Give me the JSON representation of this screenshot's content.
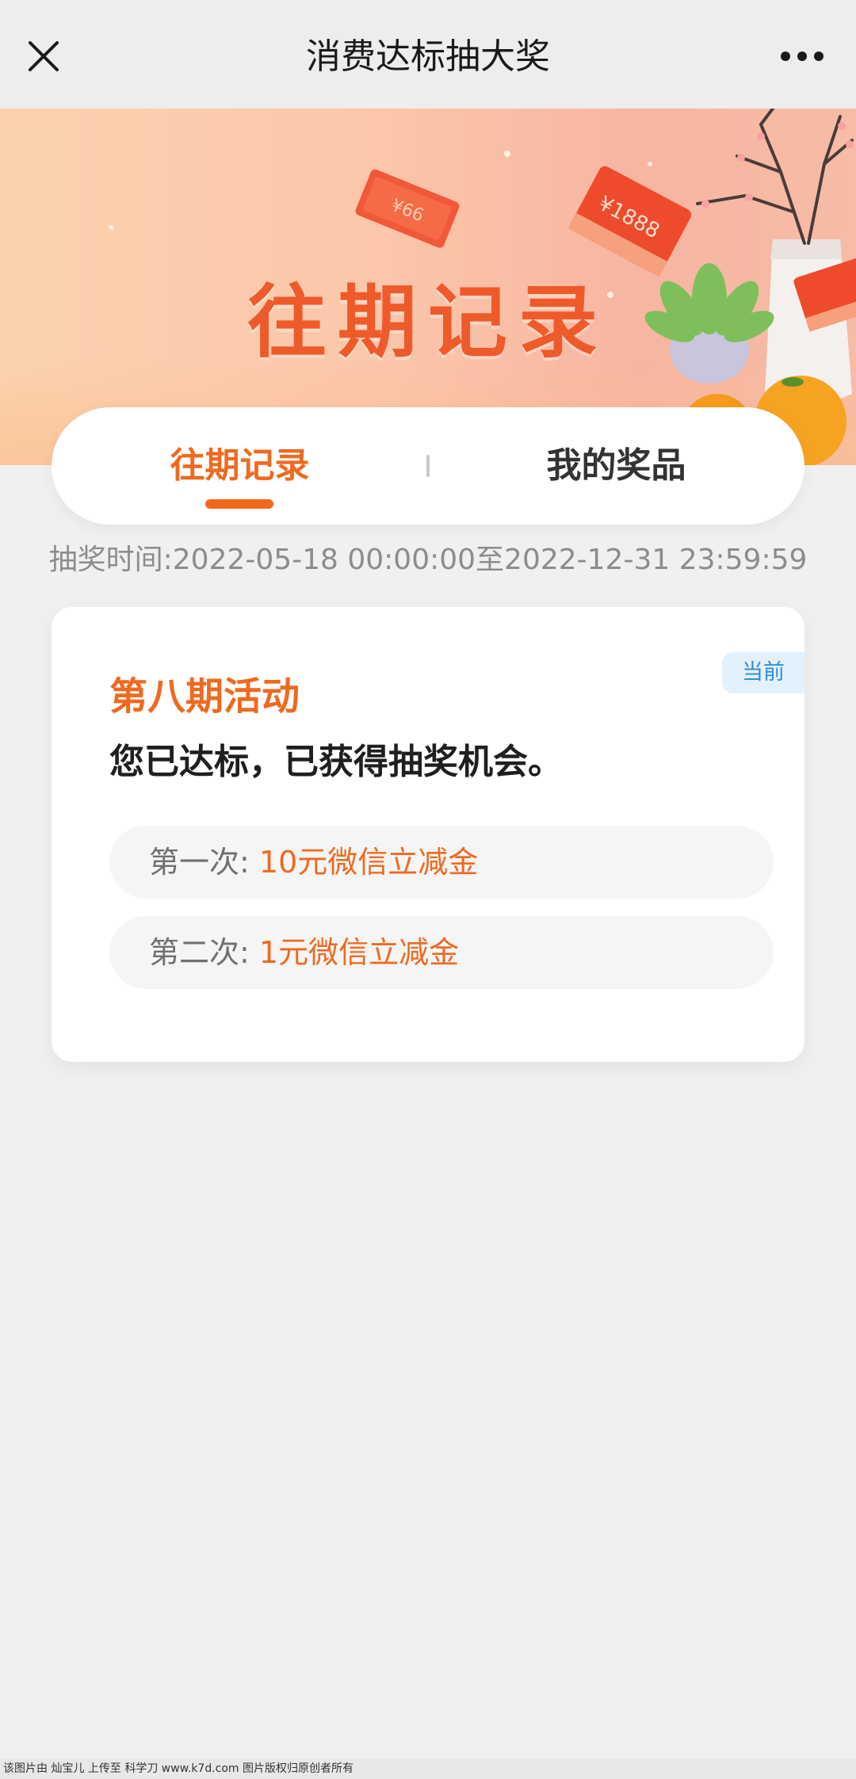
{
  "navbar": {
    "title": "消费达标抽大奖",
    "close_icon": "close-icon",
    "more_icon": "more-dots-icon"
  },
  "banner": {
    "title": "往期记录",
    "ticket_small": "¥66",
    "ticket_big": "¥1888"
  },
  "tabs": {
    "items": [
      {
        "label": "往期记录",
        "active": true
      },
      {
        "label": "我的奖品",
        "active": false
      }
    ],
    "active_color": "#EE6A20"
  },
  "draw_time": "抽奖时间:2022-05-18 00:00:00至2022-12-31 23:59:59",
  "activity": {
    "badge": "当前",
    "title": "第八期活动",
    "status": "您已达标，已获得抽奖机会。",
    "prizes": [
      {
        "label": "第一次:",
        "value": "10元微信立减金"
      },
      {
        "label": "第二次:",
        "value": "1元微信立减金"
      }
    ]
  },
  "footer_note": "该图片由 灿宝儿 上传至 科学刀 www.k7d.com 图片版权归原创者所有",
  "colors": {
    "accent": "#EE6A20",
    "badge_bg": "#E3F1FD",
    "badge_text": "#2F8ED9"
  }
}
